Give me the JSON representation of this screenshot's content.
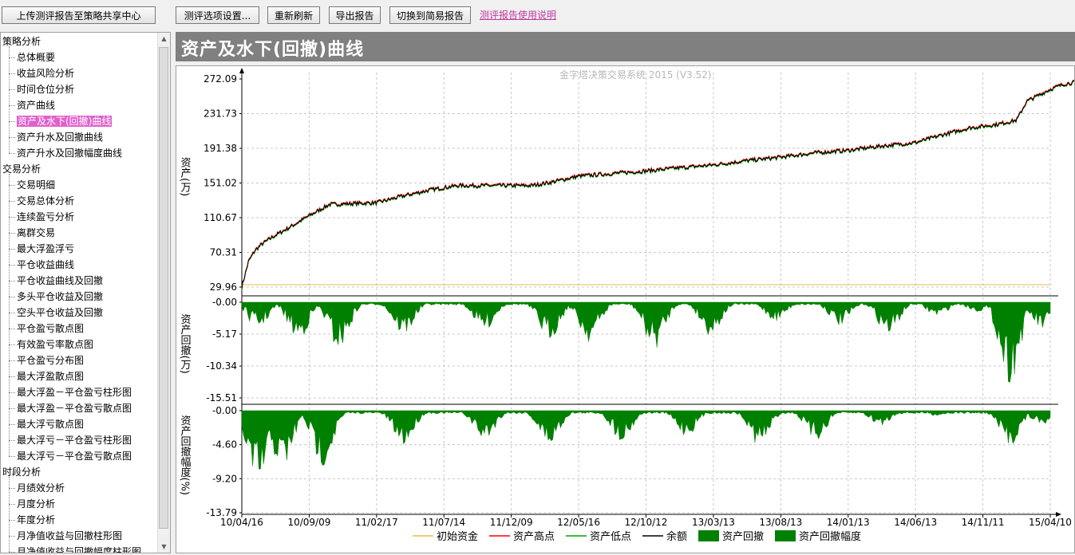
{
  "toolbar": {
    "upload_label": "上传测评报告至策略共享中心",
    "options_label": "测评选项设置...",
    "refresh_label": "重新刷新",
    "export_label": "导出报告",
    "switch_label": "切换到简易报告",
    "help_link": "测评报告使用说明"
  },
  "tree": {
    "groups": [
      {
        "label": "策略分析",
        "items": [
          "总体概要",
          "收益风险分析",
          "时间仓位分析",
          "资产曲线",
          "资产及水下(回撤)曲线",
          "资产升水及回撤曲线",
          "资产升水及回撤幅度曲线"
        ]
      },
      {
        "label": "交易分析",
        "items": [
          "交易明细",
          "交易总体分析",
          "连续盈亏分析",
          "离群交易",
          "最大浮盈浮亏",
          "平仓收益曲线",
          "平仓收益曲线及回撤",
          "多头平仓收益及回撤",
          "空头平仓收益及回撤",
          "平仓盈亏散点图",
          "有效盈亏率散点图",
          "平仓盈亏分布图",
          "最大浮盈散点图",
          "最大浮盈－平仓盈亏柱形图",
          "最大浮盈－平仓盈亏散点图",
          "最大浮亏散点图",
          "最大浮亏－平仓盈亏柱形图",
          "最大浮亏－平仓盈亏散点图"
        ]
      },
      {
        "label": "时段分析",
        "items": [
          "月绩效分析",
          "月度分析",
          "年度分析",
          "月净值收益与回撤柱形图",
          "月净值收益与回撤幅度柱形图"
        ]
      }
    ],
    "selected": "资产及水下(回撤)曲线"
  },
  "page_title": "资产及水下(回撤)曲线",
  "chart_data": {
    "type": "line",
    "watermark": "金字塔决策交易系统 2015 (V3.52)",
    "x_ticks": [
      "10/04/16",
      "10/09/09",
      "11/02/17",
      "11/07/14",
      "11/12/09",
      "12/05/16",
      "12/10/12",
      "13/03/13",
      "13/08/13",
      "14/01/13",
      "14/06/13",
      "14/11/11",
      "15/04/10"
    ],
    "panels": [
      {
        "ylabel": "资产(万)",
        "y_ticks": [
          "272.09",
          "231.73",
          "191.38",
          "151.02",
          "110.67",
          "70.31",
          "29.96"
        ],
        "ylim": [
          29.96,
          272.09
        ],
        "initial_capital": 29.96,
        "equity": [
          [
            0,
            29.96
          ],
          [
            0.1,
            60
          ],
          [
            0.2,
            73
          ],
          [
            0.3,
            80
          ],
          [
            0.45,
            88
          ],
          [
            0.7,
            99
          ],
          [
            1.0,
            113
          ],
          [
            1.3,
            126
          ],
          [
            1.6,
            127
          ],
          [
            2.0,
            128
          ],
          [
            2.4,
            136
          ],
          [
            2.8,
            143
          ],
          [
            3.2,
            148
          ],
          [
            3.7,
            148
          ],
          [
            4.3,
            148
          ],
          [
            4.6,
            152
          ],
          [
            5.0,
            159
          ],
          [
            5.5,
            162
          ],
          [
            6.0,
            165
          ],
          [
            6.4,
            168
          ],
          [
            7.0,
            172
          ],
          [
            7.5,
            177
          ],
          [
            8.0,
            181
          ],
          [
            8.5,
            186
          ],
          [
            9.0,
            189
          ],
          [
            9.5,
            194
          ],
          [
            10.0,
            198
          ],
          [
            10.4,
            207
          ],
          [
            10.8,
            215
          ],
          [
            11.2,
            219
          ],
          [
            11.5,
            224
          ],
          [
            11.65,
            246
          ],
          [
            11.8,
            252
          ],
          [
            12.0,
            260
          ],
          [
            12.2,
            266
          ],
          [
            12.35,
            268
          ],
          [
            12.45,
            272.09
          ],
          [
            12.55,
            265
          ]
        ]
      },
      {
        "ylabel": "资产回撤(万)",
        "y_ticks": [
          "-0.00",
          "-5.17",
          "-10.34",
          "-15.51"
        ],
        "ylim": [
          -15.51,
          0
        ]
      },
      {
        "ylabel": "资产回撤幅度(%)",
        "y_ticks": [
          "-0.00",
          "-4.60",
          "-9.20",
          "-13.79"
        ],
        "ylim": [
          -13.79,
          0
        ]
      }
    ],
    "legend": [
      {
        "name": "初始资金",
        "color": "#e0c040",
        "kind": "line"
      },
      {
        "name": "资产高点",
        "color": "#ff0000",
        "kind": "line"
      },
      {
        "name": "资产低点",
        "color": "#00a000",
        "kind": "line"
      },
      {
        "name": "余额",
        "color": "#000000",
        "kind": "line"
      },
      {
        "name": "资产回撤",
        "color": "#008000",
        "kind": "box"
      },
      {
        "name": "资产回撤幅度",
        "color": "#008000",
        "kind": "box"
      }
    ]
  }
}
